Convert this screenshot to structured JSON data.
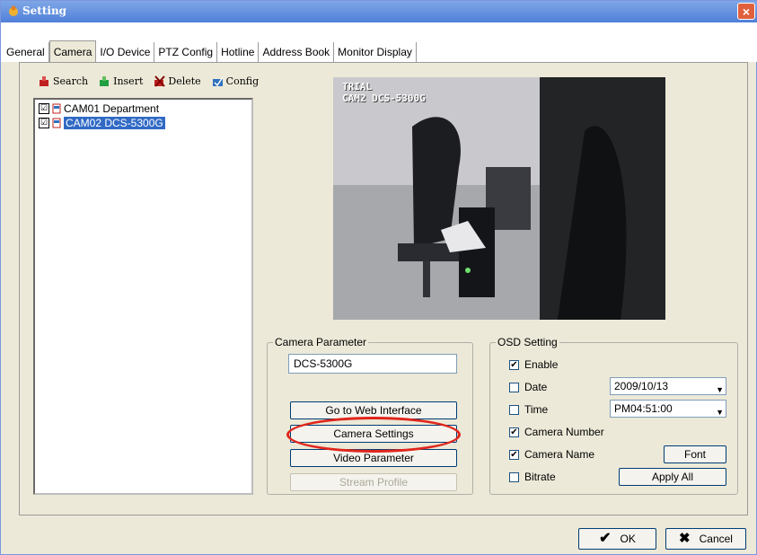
{
  "window": {
    "title": "Setting",
    "close_glyph": "×"
  },
  "tabs": [
    {
      "label": "General"
    },
    {
      "label": "Camera",
      "active": true
    },
    {
      "label": "I/O Device"
    },
    {
      "label": "PTZ Config"
    },
    {
      "label": "Hotline"
    },
    {
      "label": "Address Book"
    },
    {
      "label": "Monitor Display"
    }
  ],
  "toolbar": {
    "search": "Search",
    "insert": "Insert",
    "delete": "Delete",
    "config": "Config"
  },
  "tree": {
    "items": [
      {
        "label": "CAM01 Department",
        "checked": "☑"
      },
      {
        "label": "CAM02 DCS-5300G",
        "checked": "☑"
      }
    ]
  },
  "preview": {
    "watermark": "TRIAL",
    "caption": "CAM2 DCS-5300G"
  },
  "camera_parameter": {
    "legend": "Camera Parameter",
    "name_value": "DCS-5300G",
    "go_web": "Go to Web Interface",
    "camera_settings": "Camera Settings",
    "video_parameter": "Video Parameter",
    "stream_profile": "Stream Profile"
  },
  "osd": {
    "legend": "OSD Setting",
    "enable": {
      "label": "Enable",
      "mark": "✔"
    },
    "date": {
      "label": "Date",
      "mark": "",
      "value": "2009/10/13"
    },
    "time": {
      "label": "Time",
      "mark": "",
      "value": "PM04:51:00"
    },
    "camera_number": {
      "label": "Camera Number",
      "mark": "✔"
    },
    "camera_name": {
      "label": "Camera Name",
      "mark": "✔"
    },
    "bitrate": {
      "label": "Bitrate",
      "mark": ""
    },
    "font_button": "Font",
    "apply_all_button": "Apply All"
  },
  "footer": {
    "ok": "OK",
    "cancel": "Cancel"
  },
  "colors": {
    "accent_red": "#e0261c",
    "selection": "#316ac5",
    "titlebar": "#4f7fd9"
  }
}
